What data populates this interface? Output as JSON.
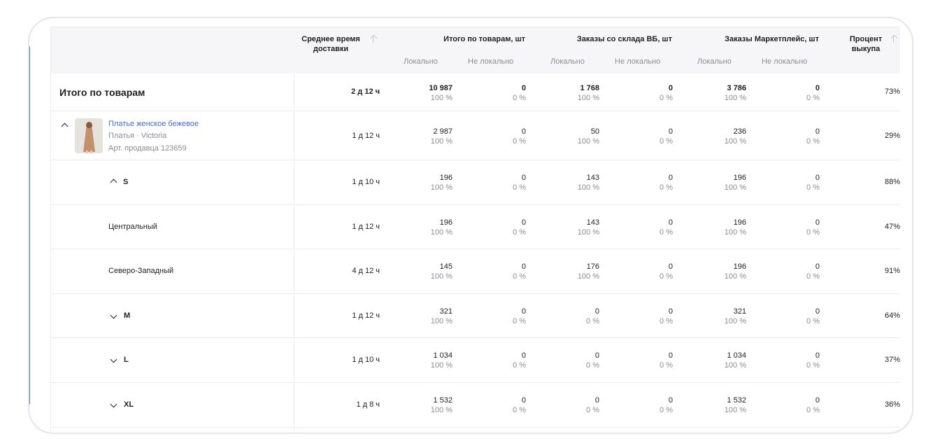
{
  "header": {
    "col_delivery": "Среднее время доставки",
    "col_total": "Итого по товарам, шт",
    "col_wb": "Заказы со склада ВБ, шт",
    "col_mp": "Заказы Маркетплейс, шт",
    "col_pct": "Процент выкупа",
    "local": "Локально",
    "non_local": "Не локально"
  },
  "rows": [
    {
      "label": "Итого по товарам",
      "delivery": "2 д 12 ч",
      "total_l": "10 987",
      "total_lp": "100 %",
      "total_n": "0",
      "total_np": "0 %",
      "wb_l": "1 768",
      "wb_lp": "100 %",
      "wb_n": "0",
      "wb_np": "0 %",
      "mp_l": "3 786",
      "mp_lp": "100 %",
      "mp_n": "0",
      "mp_np": "0 %",
      "pct": "73%"
    },
    {
      "label": "Платье женское бежевое",
      "category": "Платья · Victoria",
      "article": "Арт. продавца 123659",
      "delivery": "1 д 12 ч",
      "total_l": "2 987",
      "total_lp": "100 %",
      "total_n": "0",
      "total_np": "0 %",
      "wb_l": "50",
      "wb_lp": "100 %",
      "wb_n": "0",
      "wb_np": "0 %",
      "mp_l": "236",
      "mp_lp": "100 %",
      "mp_n": "0",
      "mp_np": "0 %",
      "pct": "29%"
    },
    {
      "label": "S",
      "delivery": "1 д 10 ч",
      "total_l": "196",
      "total_lp": "100 %",
      "total_n": "0",
      "total_np": "0 %",
      "wb_l": "143",
      "wb_lp": "100 %",
      "wb_n": "0",
      "wb_np": "0 %",
      "mp_l": "196",
      "mp_lp": "100 %",
      "mp_n": "0",
      "mp_np": "0 %",
      "pct": "88%"
    },
    {
      "label": "Центральный",
      "delivery": "1 д 12 ч",
      "total_l": "196",
      "total_lp": "100 %",
      "total_n": "0",
      "total_np": "0 %",
      "wb_l": "143",
      "wb_lp": "100 %",
      "wb_n": "0",
      "wb_np": "0 %",
      "mp_l": "196",
      "mp_lp": "100 %",
      "mp_n": "0",
      "mp_np": "0 %",
      "pct": "47%"
    },
    {
      "label": "Северо-Западный",
      "delivery": "4 д 12 ч",
      "total_l": "145",
      "total_lp": "100 %",
      "total_n": "0",
      "total_np": "0 %",
      "wb_l": "176",
      "wb_lp": "100 %",
      "wb_n": "0",
      "wb_np": "0 %",
      "mp_l": "196",
      "mp_lp": "100 %",
      "mp_n": "0",
      "mp_np": "0 %",
      "pct": "91%"
    },
    {
      "label": "M",
      "delivery": "1 д 12 ч",
      "total_l": "321",
      "total_lp": "100 %",
      "total_n": "0",
      "total_np": "0 %",
      "wb_l": "0",
      "wb_lp": "0 %",
      "wb_n": "0",
      "wb_np": "0 %",
      "mp_l": "321",
      "mp_lp": "100 %",
      "mp_n": "0",
      "mp_np": "0 %",
      "pct": "64%"
    },
    {
      "label": "L",
      "delivery": "1 д 10 ч",
      "total_l": "1 034",
      "total_lp": "100 %",
      "total_n": "0",
      "total_np": "0 %",
      "wb_l": "0",
      "wb_lp": "0 %",
      "wb_n": "0",
      "wb_np": "0 %",
      "mp_l": "1 034",
      "mp_lp": "100 %",
      "mp_n": "0",
      "mp_np": "0 %",
      "pct": "37%"
    },
    {
      "label": "XL",
      "delivery": "1 д 8 ч",
      "total_l": "1 532",
      "total_lp": "100 %",
      "total_n": "0",
      "total_np": "0 %",
      "wb_l": "0",
      "wb_lp": "0 %",
      "wb_n": "0",
      "wb_np": "0 %",
      "mp_l": "1 532",
      "mp_lp": "100 %",
      "mp_n": "0",
      "mp_np": "0 %",
      "pct": "36%"
    }
  ]
}
